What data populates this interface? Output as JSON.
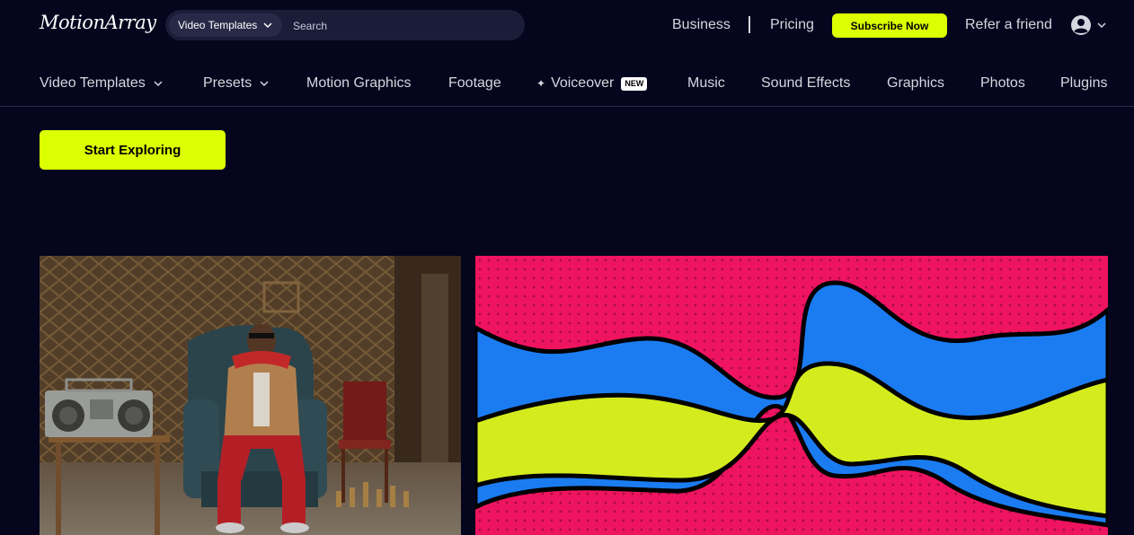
{
  "header": {
    "logo_text": "MotionArray",
    "search": {
      "category": "Video Templates",
      "placeholder": "Search"
    },
    "links": {
      "business": "Business",
      "pricing": "Pricing",
      "subscribe": "Subscribe Now",
      "refer": "Refer a friend"
    }
  },
  "nav": {
    "items": [
      {
        "label": "Video Templates"
      },
      {
        "label": "Presets"
      },
      {
        "label": "Motion Graphics"
      },
      {
        "label": "Footage"
      },
      {
        "label": "Voiceover",
        "badge": "NEW"
      },
      {
        "label": "Music"
      },
      {
        "label": "Sound Effects"
      },
      {
        "label": "Graphics"
      },
      {
        "label": "Photos"
      },
      {
        "label": "Plugins"
      }
    ]
  },
  "hero": {
    "cta_label": "Start Exploring"
  },
  "colors": {
    "background": "#05051d",
    "accent": "#dcff02",
    "pink": "#ef1460",
    "blue": "#1b7cf2",
    "lime": "#d4ec1e"
  }
}
